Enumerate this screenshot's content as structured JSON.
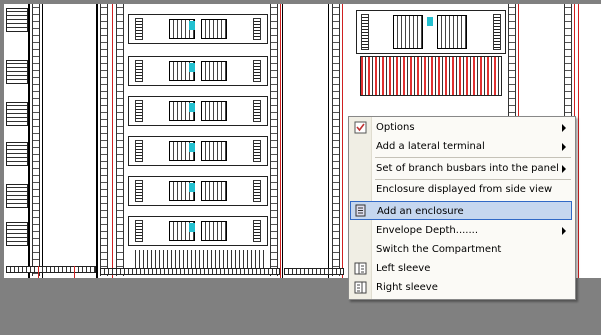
{
  "menu": {
    "items": [
      {
        "label": "Options",
        "submenu": true,
        "icon": "checkbox-icon"
      },
      {
        "label": "Add a lateral terminal",
        "submenu": true
      },
      {
        "label": "Set of branch busbars into the panel",
        "submenu": true
      },
      {
        "label": "Enclosure displayed from side view",
        "submenu": false
      },
      {
        "label": "Add an enclosure",
        "submenu": false,
        "icon": "enclosure-icon",
        "highlighted": true
      },
      {
        "label": "Envelope Depth.......",
        "submenu": true
      },
      {
        "label": "Switch the Compartment",
        "submenu": false
      },
      {
        "label": "Left sleeve",
        "submenu": false,
        "icon": "left-sleeve-icon"
      },
      {
        "label": "Right sleeve",
        "submenu": false,
        "icon": "right-sleeve-icon"
      }
    ]
  },
  "colors": {
    "background": "#808080",
    "canvas": "#ffffff",
    "highlight": "#c6d7ef",
    "highlight_border": "#3169c6",
    "accent_red": "#d02020",
    "accent_cyan": "#22c0d0"
  }
}
